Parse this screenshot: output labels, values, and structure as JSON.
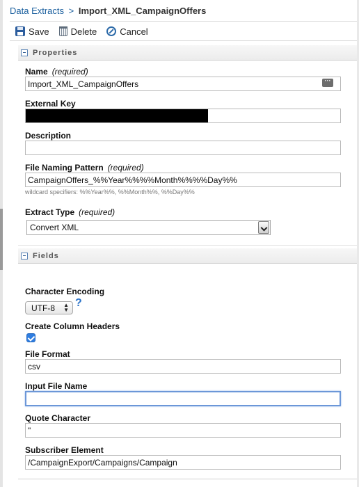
{
  "breadcrumb": {
    "parent": "Data Extracts",
    "separator": ">",
    "current": "Import_XML_CampaignOffers"
  },
  "toolbar": {
    "save_label": "Save",
    "delete_label": "Delete",
    "cancel_label": "Cancel"
  },
  "sections": {
    "properties_title": "Properties",
    "fields_title": "Fields"
  },
  "properties": {
    "name": {
      "label": "Name",
      "required": "(required)",
      "value": "Import_XML_CampaignOffers"
    },
    "external_key": {
      "label": "External Key"
    },
    "description": {
      "label": "Description",
      "value": ""
    },
    "file_naming_pattern": {
      "label": "File Naming Pattern",
      "required": "(required)",
      "value": "CampaignOffers_%%Year%%%%Month%%%%Day%%",
      "hint": "wildcard specifiers: %%Year%%, %%Month%%, %%Day%%"
    },
    "extract_type": {
      "label": "Extract Type",
      "required": "(required)",
      "selected": "Convert XML"
    }
  },
  "fields": {
    "character_encoding": {
      "label": "Character Encoding",
      "selected": "UTF-8",
      "help": "?"
    },
    "create_column_headers": {
      "label": "Create Column Headers",
      "checked": true
    },
    "file_format": {
      "label": "File Format",
      "value": "csv"
    },
    "input_file_name": {
      "label": "Input File Name",
      "value": ""
    },
    "quote_character": {
      "label": "Quote Character",
      "value": "\""
    },
    "subscriber_element": {
      "label": "Subscriber Element",
      "value": "/CampaignExport/Campaigns/Campaign"
    }
  },
  "colors": {
    "link": "#1a5f9e",
    "focus_ring": "#6c97d8",
    "checkbox": "#2f7de0",
    "help_icon": "#2d74c9"
  },
  "icons": {
    "save": "save-icon",
    "delete": "trash-icon",
    "cancel": "cancel-icon",
    "collapse": "collapse-minus-icon",
    "picker": "ellipsis-icon",
    "help": "question-icon"
  }
}
